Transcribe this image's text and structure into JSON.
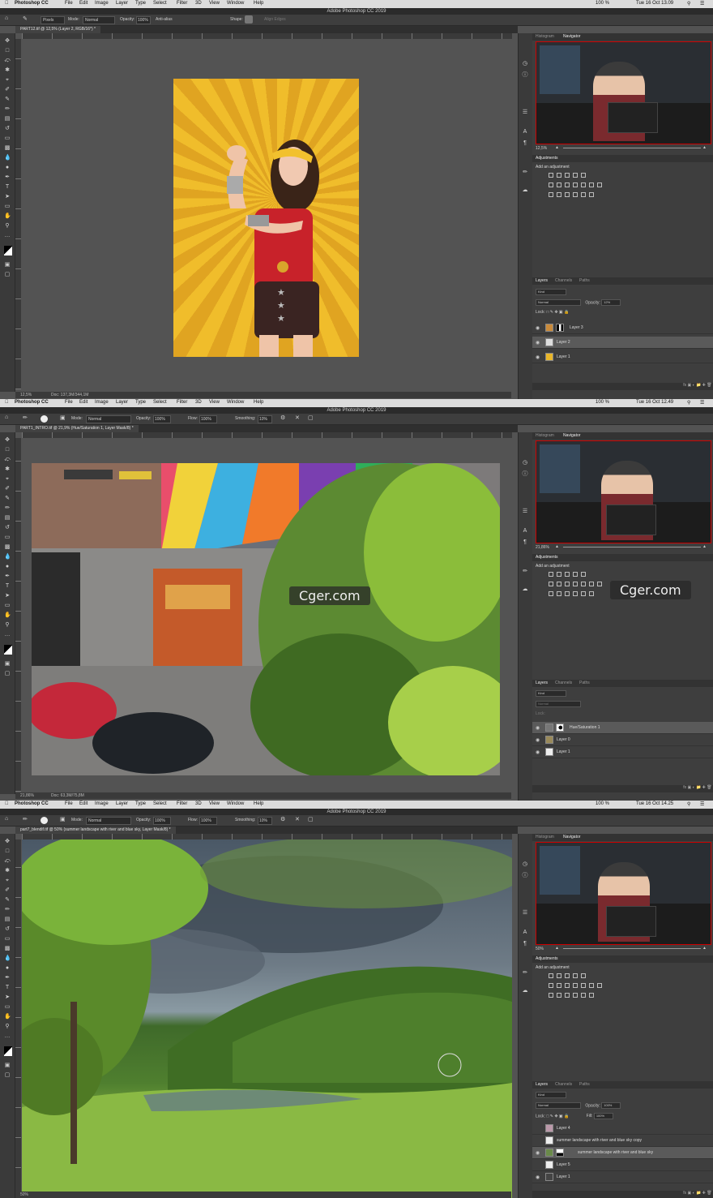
{
  "app": {
    "name": "Photoshop CC",
    "window_title": "Adobe Photoshop CC 2019"
  },
  "menu": [
    "File",
    "Edit",
    "Image",
    "Layer",
    "Type",
    "Select",
    "Filter",
    "3D",
    "View",
    "Window",
    "Help"
  ],
  "screens": [
    {
      "clock": "Tue 16 Oct  13.09",
      "battery": "100 %",
      "doc_tab": "PART12.tif @ 12,5% (Layer 2, RGB/16*) *",
      "options": {
        "preset": "Pixels",
        "mode_label": "Mode:",
        "mode": "Normal",
        "opacity_label": "Opacity:",
        "opacity": "100%",
        "anti_alias": "Anti-alias",
        "shape_label": "Shape:",
        "align_edges": "Align Edges"
      },
      "status": {
        "zoom": "12,5%",
        "doc": "Doc: 137,3M/344,1M"
      },
      "navigator": {
        "tabs": [
          "Histogram",
          "Navigator"
        ],
        "zoom": "12,5%"
      },
      "adjustments": {
        "title": "Adjustments",
        "subtitle": "Add an adjustment"
      },
      "layers_panel": {
        "tabs": [
          "Layers",
          "Channels",
          "Paths"
        ],
        "kind": "Kind",
        "blend": "Normal",
        "opacity_label": "Opacity:",
        "opacity": "12%",
        "lock_label": "Lock:",
        "fill_label": "",
        "fill": ""
      },
      "layers": [
        {
          "name": "Layer 3",
          "selected": false,
          "thumb": "#c98a3a",
          "has_mask": true
        },
        {
          "name": "Layer 2",
          "selected": true,
          "thumb": "#ddd",
          "has_mask": false
        },
        {
          "name": "Layer 1",
          "selected": false,
          "thumb": "#e9b62a",
          "has_mask": false
        }
      ]
    },
    {
      "clock": "Tue 16 Oct  12.49",
      "battery": "100 %",
      "doc_tab": "PART1_INTRO.tif @ 21,9% (Hue/Saturation 1, Layer Mask/8) *",
      "options": {
        "mode_label": "Mode:",
        "mode": "Normal",
        "opacity_label": "Opacity:",
        "opacity": "100%",
        "flow_label": "Flow:",
        "flow": "100%",
        "smoothing_label": "Smoothing:",
        "smoothing": "10%"
      },
      "status": {
        "zoom": "21,86%",
        "doc": "Doc: 63,3M/75,8M"
      },
      "navigator": {
        "tabs": [
          "Histogram",
          "Navigator"
        ],
        "zoom": "21,86%"
      },
      "adjustments": {
        "title": "Adjustments",
        "subtitle": "Add an adjustment"
      },
      "layers_panel": {
        "tabs": [
          "Layers",
          "Channels",
          "Paths"
        ],
        "kind": "Kind",
        "blend": "Normal",
        "opacity_label": "",
        "opacity": "",
        "lock_label": "Lock:",
        "fill_label": "",
        "fill": ""
      },
      "layers": [
        {
          "name": "Hue/Saturation 1",
          "selected": true,
          "thumb": "#777",
          "has_mask": true
        },
        {
          "name": "Layer 0",
          "selected": false,
          "thumb": "#9a8a5a",
          "has_mask": false
        },
        {
          "name": "Layer 1",
          "selected": false,
          "thumb": "#eee",
          "has_mask": false
        }
      ],
      "watermark": "Cger.com"
    },
    {
      "clock": "Tue 16 Oct  14.25",
      "battery": "100 %",
      "doc_tab": "part7_blendif.tif @ 50% (summer landscape with river and blue sky, Layer Mask/8) *",
      "options": {
        "mode_label": "Mode:",
        "mode": "Normal",
        "opacity_label": "Opacity:",
        "opacity": "100%",
        "flow_label": "Flow:",
        "flow": "100%",
        "smoothing_label": "Smoothing:",
        "smoothing": "10%"
      },
      "status": {
        "zoom": "50%",
        "doc": ""
      },
      "navigator": {
        "tabs": [
          "Histogram",
          "Navigator"
        ],
        "zoom": "50%"
      },
      "adjustments": {
        "title": "Adjustments",
        "subtitle": "Add an adjustment"
      },
      "layers_panel": {
        "tabs": [
          "Layers",
          "Channels",
          "Paths"
        ],
        "kind": "Kind",
        "blend": "Normal",
        "opacity_label": "Opacity:",
        "opacity": "100%",
        "lock_label": "Lock:",
        "fill_label": "Fill:",
        "fill": "100%"
      },
      "layers": [
        {
          "name": "Layer 4",
          "selected": false,
          "thumb": "#b9a",
          "has_mask": false
        },
        {
          "name": "summer landscape with river and blue sky copy",
          "selected": false,
          "thumb": "#eee",
          "has_mask": false
        },
        {
          "name": "summer landscape with river and blue sky",
          "selected": true,
          "thumb": "#6a8a4a",
          "has_mask": true
        },
        {
          "name": "Layer 5",
          "selected": false,
          "thumb": "#eee",
          "has_mask": false
        },
        {
          "name": "Layer 1",
          "selected": false,
          "thumb": "#444",
          "has_mask": false
        }
      ]
    }
  ],
  "icons": {
    "move": "move-icon",
    "marquee": "marquee-icon",
    "lasso": "lasso-icon",
    "brush": "brush-icon",
    "eye": "eye-icon"
  }
}
